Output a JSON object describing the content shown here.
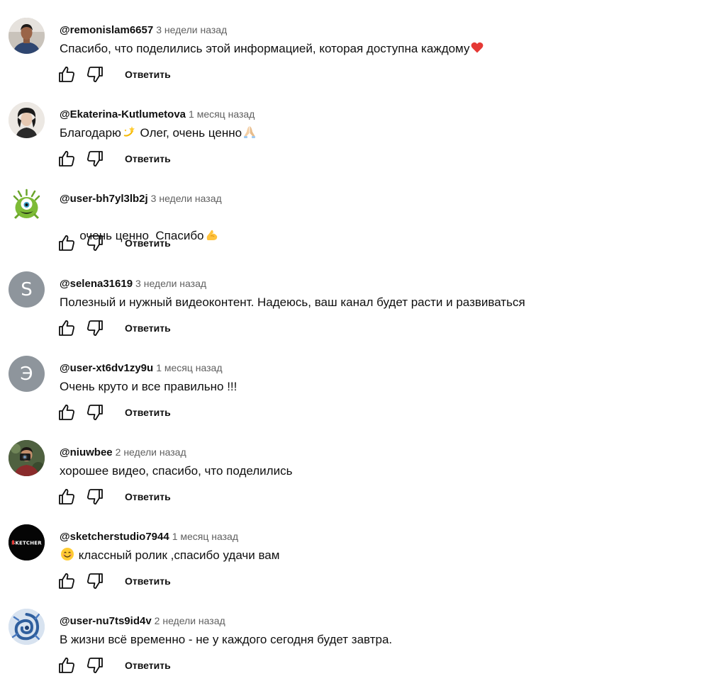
{
  "comments": [
    {
      "author": "@remonislam6657",
      "time": "3 недели назад",
      "text": "Спасибо, что поделились этой информацией, которая доступна каждому",
      "reply_label": "Ответить",
      "avatar_icon": "person-photo-icon"
    },
    {
      "author": "@Ekaterina-Kutlumetova",
      "time": "1 месяц назад",
      "text_parts": [
        "Благодарю",
        " Олег, очень ценно"
      ],
      "reply_label": "Ответить",
      "avatar_icon": "person-photo-icon"
    },
    {
      "author": "@user-bh7yl3lb2j",
      "time": "3 недели назад",
      "text": "очень ценно  Спасибо",
      "reply_label": "Ответить",
      "avatar_icon": "green-monster-icon"
    },
    {
      "author": "@selena31619",
      "time": "3 недели назад",
      "text": "Полезный и нужный видеоконтент. Надеюсь, ваш канал будет расти и развиваться",
      "reply_label": "Ответить",
      "avatar_letter": "S"
    },
    {
      "author": "@user-xt6dv1zy9u",
      "time": "1 месяц назад",
      "text": "Очень круто и все правильно !!!",
      "reply_label": "Ответить",
      "avatar_letter": "Э"
    },
    {
      "author": "@niuwbee",
      "time": "2 недели назад",
      "text": "хорошее видео, спасибо, что поделились",
      "reply_label": "Ответить",
      "avatar_icon": "photographer-icon"
    },
    {
      "author": "@sketcherstudio7944",
      "time": "1 месяц назад",
      "text": " классный ролик ,спасибо удачи вам",
      "reply_label": "Ответить",
      "avatar_logo_text": "SKETCHER"
    },
    {
      "author": "@user-nu7ts9id4v",
      "time": "2 недели назад",
      "text": "В жизни всё временно - не у каждого сегодня будет завтра.",
      "reply_label": "Ответить",
      "avatar_icon": "blue-swirl-icon"
    }
  ],
  "icons": {
    "like": "thumbs-up-icon",
    "dislike": "thumbs-down-icon",
    "emoji_heart": "red-heart-icon",
    "emoji_dizzy": "dizzy-star-icon",
    "emoji_pray": "folded-hands-icon",
    "emoji_muscle": "flexed-biceps-icon",
    "emoji_smile": "smiling-face-icon"
  },
  "colors": {
    "text": "#0f0f0f",
    "secondary": "#606060",
    "letter_avatar_bg": "#8e959c"
  }
}
